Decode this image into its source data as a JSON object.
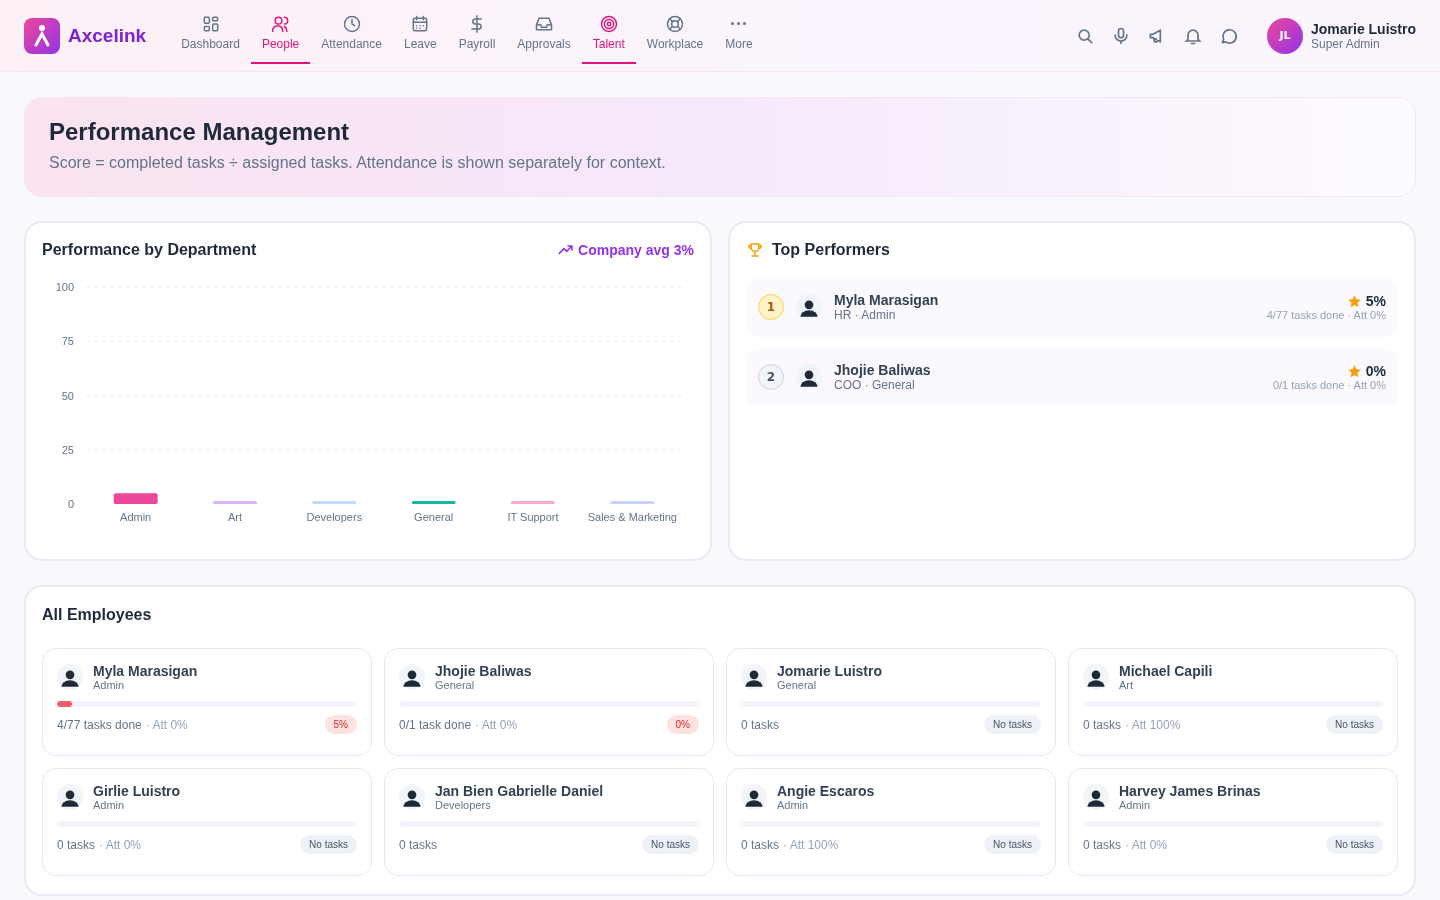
{
  "brand": {
    "name": "Axcelink"
  },
  "nav": [
    {
      "label": "Dashboard",
      "selected": false
    },
    {
      "label": "People",
      "selected": true
    },
    {
      "label": "Attendance",
      "selected": false
    },
    {
      "label": "Leave",
      "selected": false
    },
    {
      "label": "Payroll",
      "selected": false
    },
    {
      "label": "Approvals",
      "selected": false
    },
    {
      "label": "Talent",
      "selected": true
    },
    {
      "label": "Workplace",
      "selected": false
    },
    {
      "label": "More",
      "selected": false
    }
  ],
  "user": {
    "initials": "JL",
    "name": "Jomarie Luistro",
    "role": "Super Admin"
  },
  "banner": {
    "title": "Performance Management",
    "subtitle": "Score = completed tasks ÷ assigned tasks. Attendance is shown separately for context."
  },
  "department_chart": {
    "title": "Performance by Department",
    "average": "Company avg 3%",
    "chart_data": {
      "type": "bar",
      "categories": [
        "Admin",
        "Art",
        "Developers",
        "General",
        "IT Support",
        "Sales & Marketing"
      ],
      "series": [
        {
          "colors": [
            "#ec4899",
            "#d8b4fe",
            "#bfdbfe",
            "#14b8a6",
            "#f9a8d4",
            "#c7d2fe"
          ],
          "values": [
            5,
            0,
            0,
            0,
            0,
            0
          ]
        }
      ],
      "ylim": [
        0,
        100
      ],
      "yticks": [
        0,
        25,
        50,
        75,
        100
      ],
      "grid": true
    }
  },
  "top_performers": {
    "title": "Top Performers",
    "items": [
      {
        "rank": "1",
        "name": "Myla Marasigan",
        "role": "HR · Admin",
        "score": "5%",
        "detail": "4/77 tasks done · Att 0%",
        "highlight": true
      },
      {
        "rank": "2",
        "name": "Jhojie Baliwas",
        "role": "COO · General",
        "score": "0%",
        "detail": "0/1 tasks done · Att 0%",
        "highlight": false
      }
    ]
  },
  "employees": {
    "title": "All Employees",
    "items": [
      {
        "name": "Myla Marasigan",
        "department": "Admin",
        "level": 0.05,
        "tasks": "4/77 tasks done",
        "attendance": "· Att 0%",
        "badge": "5%",
        "kind": "scored"
      },
      {
        "name": "Jhojie Baliwas",
        "department": "General",
        "tasks": "0/1 task done",
        "attendance": "· Att 0%",
        "badge": "0%",
        "kind": "scored"
      },
      {
        "name": "Jomarie Luistro",
        "department": "General",
        "tasks": "0 tasks",
        "badge": "No tasks",
        "kind": "empty"
      },
      {
        "name": "Michael Capili",
        "department": "Art",
        "tasks": "0 tasks",
        "attendance": "· Att 100%",
        "badge": "No tasks",
        "kind": "empty"
      },
      {
        "name": "Girlie Luistro",
        "department": "Admin",
        "tasks": "0 tasks",
        "attendance": "· Att 0%",
        "badge": "No tasks",
        "kind": "empty"
      },
      {
        "name": "Jan Bien Gabrielle Daniel",
        "department": "Developers",
        "tasks": "0 tasks",
        "badge": "No tasks",
        "kind": "empty"
      },
      {
        "name": "Angie Escaros",
        "department": "Admin",
        "tasks": "0 tasks",
        "attendance": "· Att 100%",
        "badge": "No tasks",
        "kind": "empty"
      },
      {
        "name": "Harvey James Brinas",
        "department": "Admin",
        "tasks": "0 tasks",
        "attendance": "· Att 0%",
        "badge": "No tasks",
        "kind": "empty"
      }
    ]
  }
}
